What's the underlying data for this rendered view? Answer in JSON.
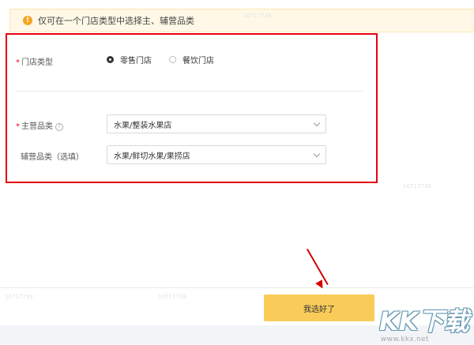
{
  "notice": {
    "icon": "warning-icon",
    "text": "仅可在一个门店类型中选择主、辅营品类"
  },
  "form": {
    "store_type": {
      "label": "门店类型",
      "options": [
        {
          "label": "零售门店",
          "selected": true
        },
        {
          "label": "餐饮门店",
          "selected": false
        }
      ]
    },
    "main_category": {
      "label": "主营品类",
      "value": "水果/整装水果店"
    },
    "sub_category": {
      "label": "辅营品类（选填）",
      "value": "水果/鲜切水果/果捞店"
    }
  },
  "confirm_button": {
    "label": "我选好了"
  },
  "watermark": {
    "logo_text": "KK下载",
    "url": "www.kkx.net",
    "faint_id": "10717739"
  },
  "colors": {
    "highlight_border": "#e60012",
    "button_bg": "#f9cc5a",
    "notice_bg": "#fff8e6",
    "arrow": "#d40000"
  }
}
